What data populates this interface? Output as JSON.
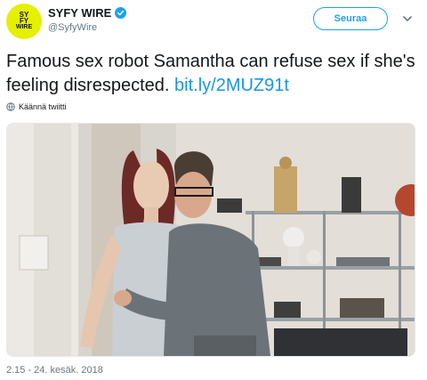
{
  "account": {
    "display_name": "SYFY WIRE",
    "handle": "@SyfyWire",
    "avatar_line1": "SY",
    "avatar_line2": "FY",
    "avatar_line3": "WIRE",
    "avatar_color": "#e4f000"
  },
  "follow_label": "Seuraa",
  "tweet": {
    "text": "Famous sex robot Samantha can refuse sex if she's feeling disrespected.",
    "link": "bit.ly/2MUZ91t",
    "translate_label": "Käännä twiitti"
  },
  "timestamp": "2.15 - 24. kesäk. 2018",
  "colors": {
    "accent": "#1da1f2",
    "link": "#1b95e0",
    "muted": "#657786"
  },
  "icons": {
    "verified": "verified-badge-icon",
    "more": "chevron-down-icon",
    "translate": "globe-icon"
  }
}
